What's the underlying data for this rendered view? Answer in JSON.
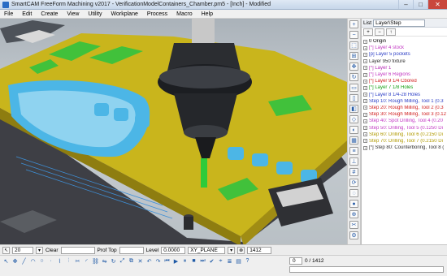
{
  "window": {
    "title": "SmartCAM FreeForm Machining v2017 - VerificationModelContainers_Chamber.pm5 - [Inch] - Modified",
    "controls": [
      "–",
      "□",
      "✕"
    ]
  },
  "menu": [
    "File",
    "Edit",
    "Create",
    "View",
    "Utility",
    "Workplane",
    "Process",
    "Macro",
    "Help"
  ],
  "panel": {
    "list_label": "List",
    "list_value": "Layer\\Step",
    "buttons": [
      "+",
      "−",
      "↑"
    ],
    "items": [
      {
        "text": "0 Origin",
        "color": "#000000"
      },
      {
        "text": "[*] Layer 4 stock",
        "color": "#c238c2"
      },
      {
        "text": "[p] Layer 5 pockets",
        "color": "#2c3ec6"
      },
      {
        "text": "Layer 950 fixture",
        "color": "#303030"
      },
      {
        "text": "[*] Layer 1",
        "color": "#b52ab5"
      },
      {
        "text": "[*] Layer 6 Regions",
        "color": "#c238c2"
      },
      {
        "text": "[*] Layer 9 1/4 Cbored",
        "color": "#d01c1c"
      },
      {
        "text": "[*] Layer 7 1/8 Holes",
        "color": "#14a014"
      },
      {
        "text": "[*] Layer 8 1/4-28 Holes",
        "color": "#2c3ec6"
      },
      {
        "text": "Step 10: Rough Milling, Tool 1 (0.3",
        "color": "#2c3ec6"
      },
      {
        "text": "Step 20: Rough Milling, Tool 2 (0.3",
        "color": "#d01c1c"
      },
      {
        "text": "Step 30: Rough Milling, Tool 3 (0.12",
        "color": "#d01c1c"
      },
      {
        "text": "Step 40: Spot Drilling, Tool 4 (0.20",
        "color": "#c238c2"
      },
      {
        "text": "Step 50: Drilling, Tool 5 (0.1250 Di",
        "color": "#c238c2"
      },
      {
        "text": "Step 60: Drilling, Tool 6 (0.2150 Di",
        "color": "#b09a00"
      },
      {
        "text": "Step 70: Drilling, Tool 7 (0.2150 Di",
        "color": "#b09a00"
      },
      {
        "text": "[*] Step 80: Counterboring, Tool 8 (",
        "color": "#303030"
      }
    ]
  },
  "bottom_toolbar": {
    "value_field": "20",
    "clear_label": "Clear",
    "prof_label": "Prof Top",
    "level_label": "Level",
    "level_value": "0.0000",
    "plane_value": "XY_PLANE",
    "count_value": "1412"
  },
  "status": {
    "counter_current": "0",
    "counter_text": "0 / 1412",
    "progress": 0.0
  },
  "colors": {
    "part_yellow": "#c9b51c",
    "pocket_green": "#41c13b",
    "pocket_blue": "#4cb6e6",
    "tool_dark": "#1c1e22"
  }
}
